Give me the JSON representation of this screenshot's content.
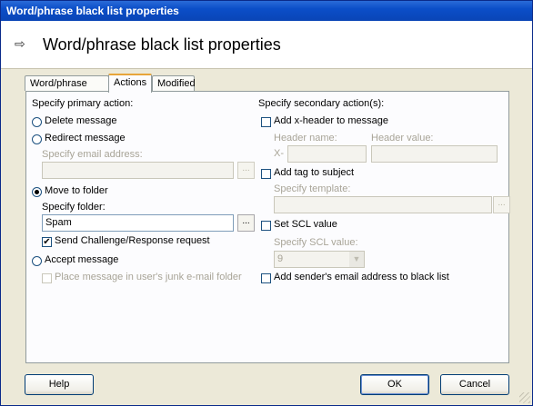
{
  "window": {
    "title": "Word/phrase black list properties"
  },
  "header": {
    "icon": "filter-edit-icon",
    "title": "Word/phrase black list properties"
  },
  "tabs": [
    {
      "label": "Word/phrase filter",
      "active": false
    },
    {
      "label": "Actions",
      "active": true
    },
    {
      "label": "Modified",
      "active": false
    }
  ],
  "primary": {
    "heading": "Specify primary action:",
    "delete_label": "Delete message",
    "redirect_label": "Redirect message",
    "email_label": "Specify email address:",
    "email_value": "",
    "move_label": "Move to folder",
    "folder_label": "Specify folder:",
    "folder_value": "Spam",
    "challenge_label": "Send Challenge/Response request",
    "accept_label": "Accept message",
    "junk_label": "Place message in user's junk e-mail folder",
    "selected": "Move to folder",
    "challenge_checked": true,
    "junk_checked": false
  },
  "secondary": {
    "heading": "Specify secondary action(s):",
    "xheader_label": "Add x-header to message",
    "header_name_label": "Header name:",
    "header_value_label": "Header value:",
    "x_prefix": "X-",
    "header_name_value": "",
    "header_value_value": "",
    "tag_label": "Add tag to subject",
    "template_label": "Specify template:",
    "template_value": "",
    "scl_label": "Set SCL value",
    "scl_value_label": "Specify SCL value:",
    "scl_value": "9",
    "blacklist_label": "Add sender's email address to black list",
    "xheader_checked": false,
    "tag_checked": false,
    "scl_checked": false,
    "blacklist_checked": false
  },
  "browse_label": "...",
  "footer": {
    "help_label": "Help",
    "ok_label": "OK",
    "cancel_label": "Cancel"
  }
}
